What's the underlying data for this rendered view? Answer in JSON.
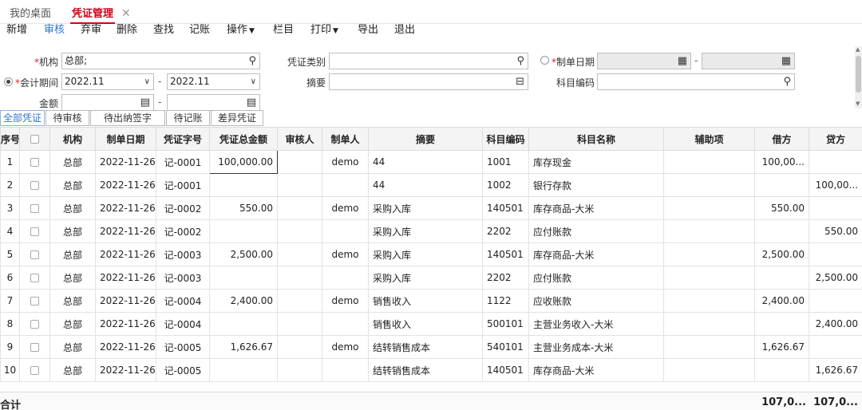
{
  "tabs": [
    {
      "label": "我的桌面"
    },
    {
      "label": "凭证管理"
    }
  ],
  "toolbar": {
    "items": [
      "新增",
      "审核",
      "弃审",
      "删除",
      "查找",
      "记账",
      "操作",
      "栏目",
      "打印",
      "导出",
      "退出"
    ]
  },
  "filters": {
    "org_label": "机构",
    "org_value": "总部;",
    "voucher_type_label": "凭证类别",
    "voucher_type_value": "",
    "date_label": "制单日期",
    "period_label": "会计期间",
    "period_from": "2022.11",
    "period_to": "2022.11",
    "summary_label": "摘要",
    "summary_value": "",
    "account_code_label": "科目编码",
    "account_code_value": "",
    "amount_label": "金额",
    "dash": "-"
  },
  "filter_tabs": [
    "全部凭证",
    "待审核",
    "待出纳签字",
    "待记账",
    "差异凭证"
  ],
  "table": {
    "headers": [
      "序号",
      "",
      "机构",
      "制单日期",
      "凭证字号",
      "凭证总金额",
      "审核人",
      "制单人",
      "摘要",
      "科目编码",
      "科目名称",
      "辅助项",
      "借方",
      "贷方"
    ],
    "rows": [
      {
        "no": "1",
        "org": "总部",
        "date": "2022-11-26",
        "vno": "记-0001",
        "total": "100,000.00",
        "auditor": "",
        "maker": "demo",
        "summary": "44",
        "code": "1001",
        "name": "库存现金",
        "aux": "",
        "debit": "100,00...",
        "credit": ""
      },
      {
        "no": "2",
        "org": "总部",
        "date": "2022-11-26",
        "vno": "记-0001",
        "total": "",
        "auditor": "",
        "maker": "",
        "summary": "44",
        "code": "1002",
        "name": "银行存款",
        "aux": "",
        "debit": "",
        "credit": "100,00..."
      },
      {
        "no": "3",
        "org": "总部",
        "date": "2022-11-26",
        "vno": "记-0002",
        "total": "550.00",
        "auditor": "",
        "maker": "demo",
        "summary": "采购入库",
        "code": "140501",
        "name": "库存商品-大米",
        "aux": "",
        "debit": "550.00",
        "credit": ""
      },
      {
        "no": "4",
        "org": "总部",
        "date": "2022-11-26",
        "vno": "记-0002",
        "total": "",
        "auditor": "",
        "maker": "",
        "summary": "采购入库",
        "code": "2202",
        "name": "应付账款",
        "aux": "",
        "debit": "",
        "credit": "550.00"
      },
      {
        "no": "5",
        "org": "总部",
        "date": "2022-11-26",
        "vno": "记-0003",
        "total": "2,500.00",
        "auditor": "",
        "maker": "demo",
        "summary": "采购入库",
        "code": "140501",
        "name": "库存商品-大米",
        "aux": "",
        "debit": "2,500.00",
        "credit": ""
      },
      {
        "no": "6",
        "org": "总部",
        "date": "2022-11-26",
        "vno": "记-0003",
        "total": "",
        "auditor": "",
        "maker": "",
        "summary": "采购入库",
        "code": "2202",
        "name": "应付账款",
        "aux": "",
        "debit": "",
        "credit": "2,500.00"
      },
      {
        "no": "7",
        "org": "总部",
        "date": "2022-11-26",
        "vno": "记-0004",
        "total": "2,400.00",
        "auditor": "",
        "maker": "demo",
        "summary": "销售收入",
        "code": "1122",
        "name": "应收账款",
        "aux": "",
        "debit": "2,400.00",
        "credit": ""
      },
      {
        "no": "8",
        "org": "总部",
        "date": "2022-11-26",
        "vno": "记-0004",
        "total": "",
        "auditor": "",
        "maker": "",
        "summary": "销售收入",
        "code": "500101",
        "name": "主营业务收入-大米",
        "aux": "",
        "debit": "",
        "credit": "2,400.00"
      },
      {
        "no": "9",
        "org": "总部",
        "date": "2022-11-26",
        "vno": "记-0005",
        "total": "1,626.67",
        "auditor": "",
        "maker": "demo",
        "summary": "结转销售成本",
        "code": "540101",
        "name": "主营业务成本-大米",
        "aux": "",
        "debit": "1,626.67",
        "credit": ""
      },
      {
        "no": "10",
        "org": "总部",
        "date": "2022-11-26",
        "vno": "记-0005",
        "total": "",
        "auditor": "",
        "maker": "",
        "summary": "结转销售成本",
        "code": "140501",
        "name": "库存商品-大米",
        "aux": "",
        "debit": "",
        "credit": "1,626.67"
      }
    ]
  },
  "totals": {
    "label": "合计",
    "debit": "107,0...",
    "credit": "107,0..."
  },
  "colors": {
    "accent": "#2e74c9",
    "active_tab": "#d0021b",
    "required": "#e02020"
  }
}
